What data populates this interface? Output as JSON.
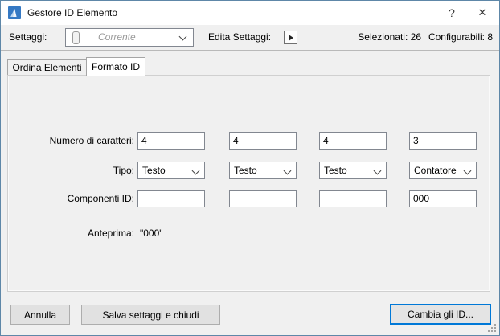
{
  "window": {
    "title": "Gestore ID Elemento",
    "help": "?",
    "close": "✕"
  },
  "settings_bar": {
    "label": "Settaggi:",
    "combo_value": "Corrente",
    "edit_label": "Edita Settaggi:",
    "selected": "Selezionati: 26",
    "configurable": "Configurabili: 8"
  },
  "tabs": [
    {
      "label": "Ordina Elementi",
      "active": false
    },
    {
      "label": "Formato ID",
      "active": true
    }
  ],
  "form": {
    "chars": {
      "label": "Numero di caratteri:",
      "values": [
        "4",
        "4",
        "4",
        "3"
      ]
    },
    "type": {
      "label": "Tipo:",
      "values": [
        "Testo",
        "Testo",
        "Testo",
        "Contatore"
      ]
    },
    "components": {
      "label": "Componenti ID:",
      "values": [
        "",
        "",
        "",
        "000"
      ]
    },
    "preview": {
      "label": "Anteprima:",
      "value": "\"000\""
    }
  },
  "footer": {
    "cancel": "Annulla",
    "save": "Salva settaggi e chiudi",
    "change": "Cambia gli ID..."
  },
  "colors": {
    "accent": "#0078d7",
    "window_border": "#5e87a8",
    "titlebar_bg": "#ffffff",
    "dialog_bg": "#f0f0f0",
    "input_border": "#828790"
  }
}
